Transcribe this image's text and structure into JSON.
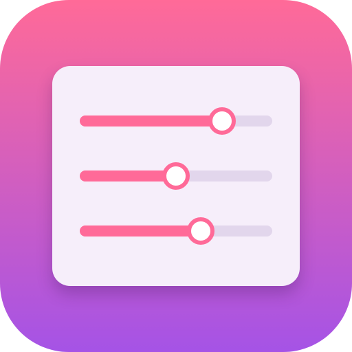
{
  "icon": {
    "name": "sliders-settings-icon",
    "colors": {
      "gradient_top": "#FF6A98",
      "gradient_bottom": "#A553E6",
      "panel": "#F6EEFA",
      "accent": "#FF6A98",
      "track": "#E2D6EC"
    }
  },
  "sliders": [
    {
      "level": 0.74
    },
    {
      "level": 0.5
    },
    {
      "level": 0.63
    }
  ]
}
